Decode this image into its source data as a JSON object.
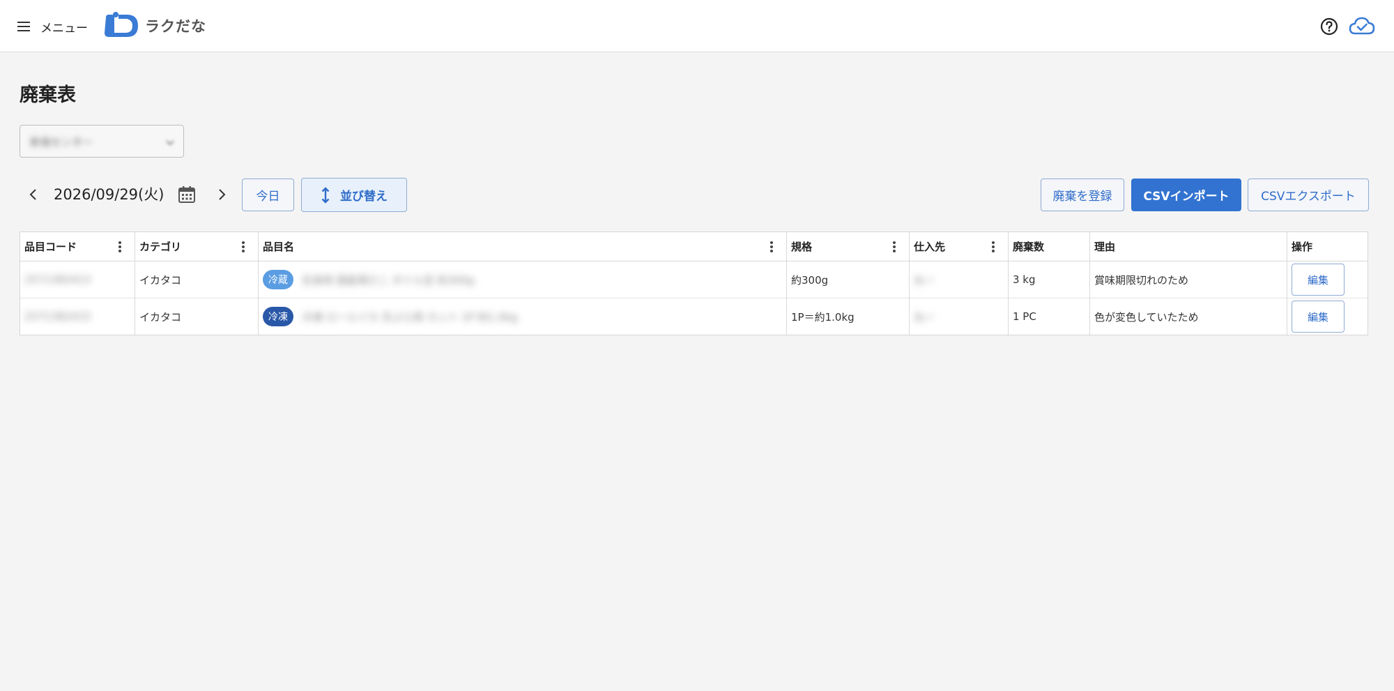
{
  "header": {
    "menu_label": "メニュー",
    "logo_text": "ラクだな",
    "brand_color": "#3a7bd5"
  },
  "page": {
    "title": "廃棄表"
  },
  "store_select": {
    "value": "新宿センター"
  },
  "date_nav": {
    "date": "2026/09/29(火)"
  },
  "toolbar": {
    "today_label": "今日",
    "sort_label": "並び替え",
    "register_label": "廃棄を登録",
    "import_label": "CSVインポート",
    "export_label": "CSVエクスポート"
  },
  "table": {
    "columns": [
      "品目コード",
      "カテゴリ",
      "品目名",
      "規格",
      "仕入先",
      "廃棄数",
      "理由",
      "操作"
    ],
    "rows": [
      {
        "code": "2571382413",
        "category": "イカタコ",
        "tag": "冷蔵",
        "name": "生食用 国産真だこ ボイル足 約300g",
        "spec": "約300g",
        "supplier": "丸一",
        "quantity": "3 kg",
        "reason": "賞味期限切れのため",
        "action": "編集"
      },
      {
        "code": "2571382415",
        "category": "イカタコ",
        "tag": "冷凍",
        "name": "冷凍 ロールイカ 天ぷら用 カット 1P 約1.0kg",
        "spec": "1P＝約1.0kg",
        "supplier": "丸一",
        "quantity": "1 PC",
        "reason": "色が変色していたため",
        "action": "編集"
      }
    ]
  }
}
